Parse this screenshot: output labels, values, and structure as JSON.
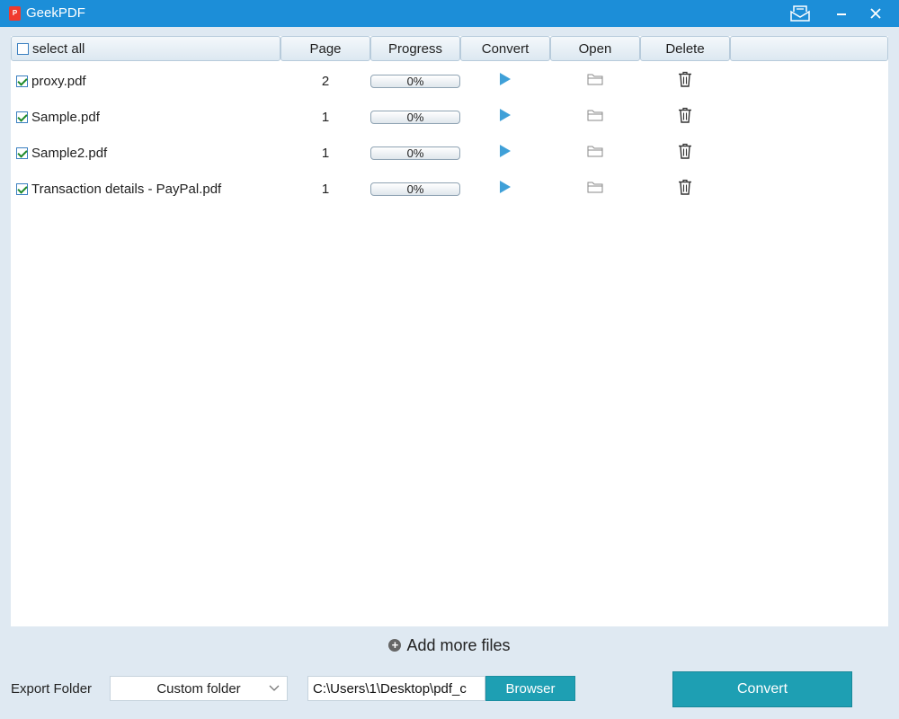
{
  "window": {
    "title": "GeekPDF",
    "logo_letter": "P"
  },
  "table": {
    "select_all_label": "select all",
    "columns": [
      "Page",
      "Progress",
      "Convert",
      "Open",
      "Delete"
    ],
    "rows": [
      {
        "name": "proxy.pdf",
        "page": "2",
        "progress": 0,
        "progress_label": "0%",
        "checked": true
      },
      {
        "name": "Sample.pdf",
        "page": "1",
        "progress": 0,
        "progress_label": "0%",
        "checked": true
      },
      {
        "name": "Sample2.pdf",
        "page": "1",
        "progress": 0,
        "progress_label": "0%",
        "checked": true
      },
      {
        "name": "Transaction details - PayPal.pdf",
        "page": "1",
        "progress": 0,
        "progress_label": "0%",
        "checked": true
      }
    ],
    "icons": {
      "convert": "play-icon",
      "open": "folder-icon",
      "delete": "trash-icon"
    }
  },
  "add_more_label": "Add more files",
  "footer": {
    "export_label": "Export Folder",
    "folder_mode": "Custom folder",
    "path": "C:\\Users\\1\\Desktop\\pdf_c",
    "browse_label": "Browser",
    "convert_label": "Convert"
  },
  "colors": {
    "titlebar": "#1c8ed8",
    "accent": "#1e9fb3",
    "play": "#3fa0d8",
    "progress_fill": "#4aa0d8"
  }
}
